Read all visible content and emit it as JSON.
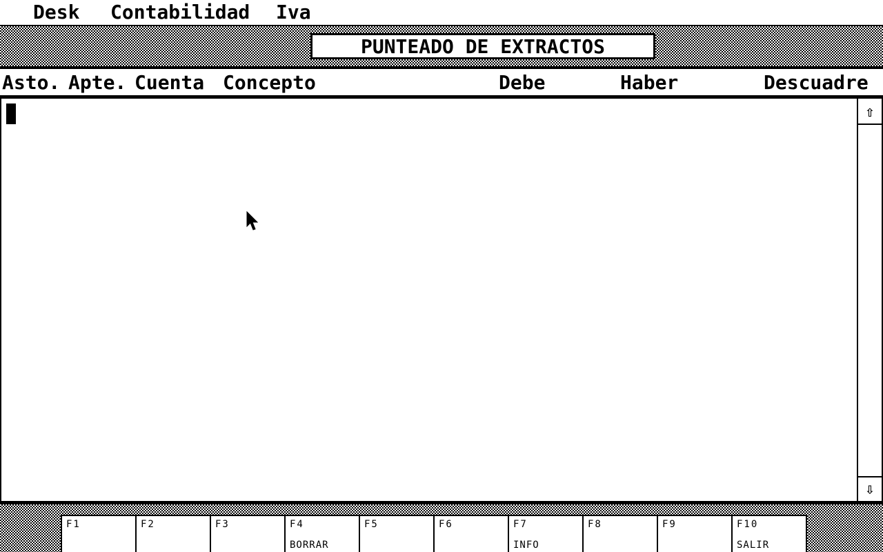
{
  "menubar": {
    "items": [
      {
        "label": "Desk"
      },
      {
        "label": "Contabilidad"
      },
      {
        "label": "Iva"
      }
    ]
  },
  "window": {
    "title": "PUNTEADO DE EXTRACTOS"
  },
  "columns": [
    {
      "label": "Asto."
    },
    {
      "label": "Apte."
    },
    {
      "label": "Cuenta"
    },
    {
      "label": "Concepto"
    },
    {
      "label": "Debe"
    },
    {
      "label": "Haber"
    },
    {
      "label": "Descuadre"
    }
  ],
  "scrollbar": {
    "up_glyph": "⇧",
    "down_glyph": "⇩"
  },
  "function_keys": [
    {
      "key": "F1",
      "label": ""
    },
    {
      "key": "F2",
      "label": ""
    },
    {
      "key": "F3",
      "label": ""
    },
    {
      "key": "F4",
      "label": "BORRAR"
    },
    {
      "key": "F5",
      "label": ""
    },
    {
      "key": "F6",
      "label": ""
    },
    {
      "key": "F7",
      "label": "INFO"
    },
    {
      "key": "F8",
      "label": ""
    },
    {
      "key": "F9",
      "label": ""
    },
    {
      "key": "F10",
      "label": "SALIR"
    }
  ],
  "icons": {
    "pointer": "arrow-pointer-icon",
    "scroll_up": "arrow-up-icon",
    "scroll_down": "arrow-down-icon"
  },
  "colors": {
    "foreground": "#000000",
    "background": "#ffffff"
  }
}
